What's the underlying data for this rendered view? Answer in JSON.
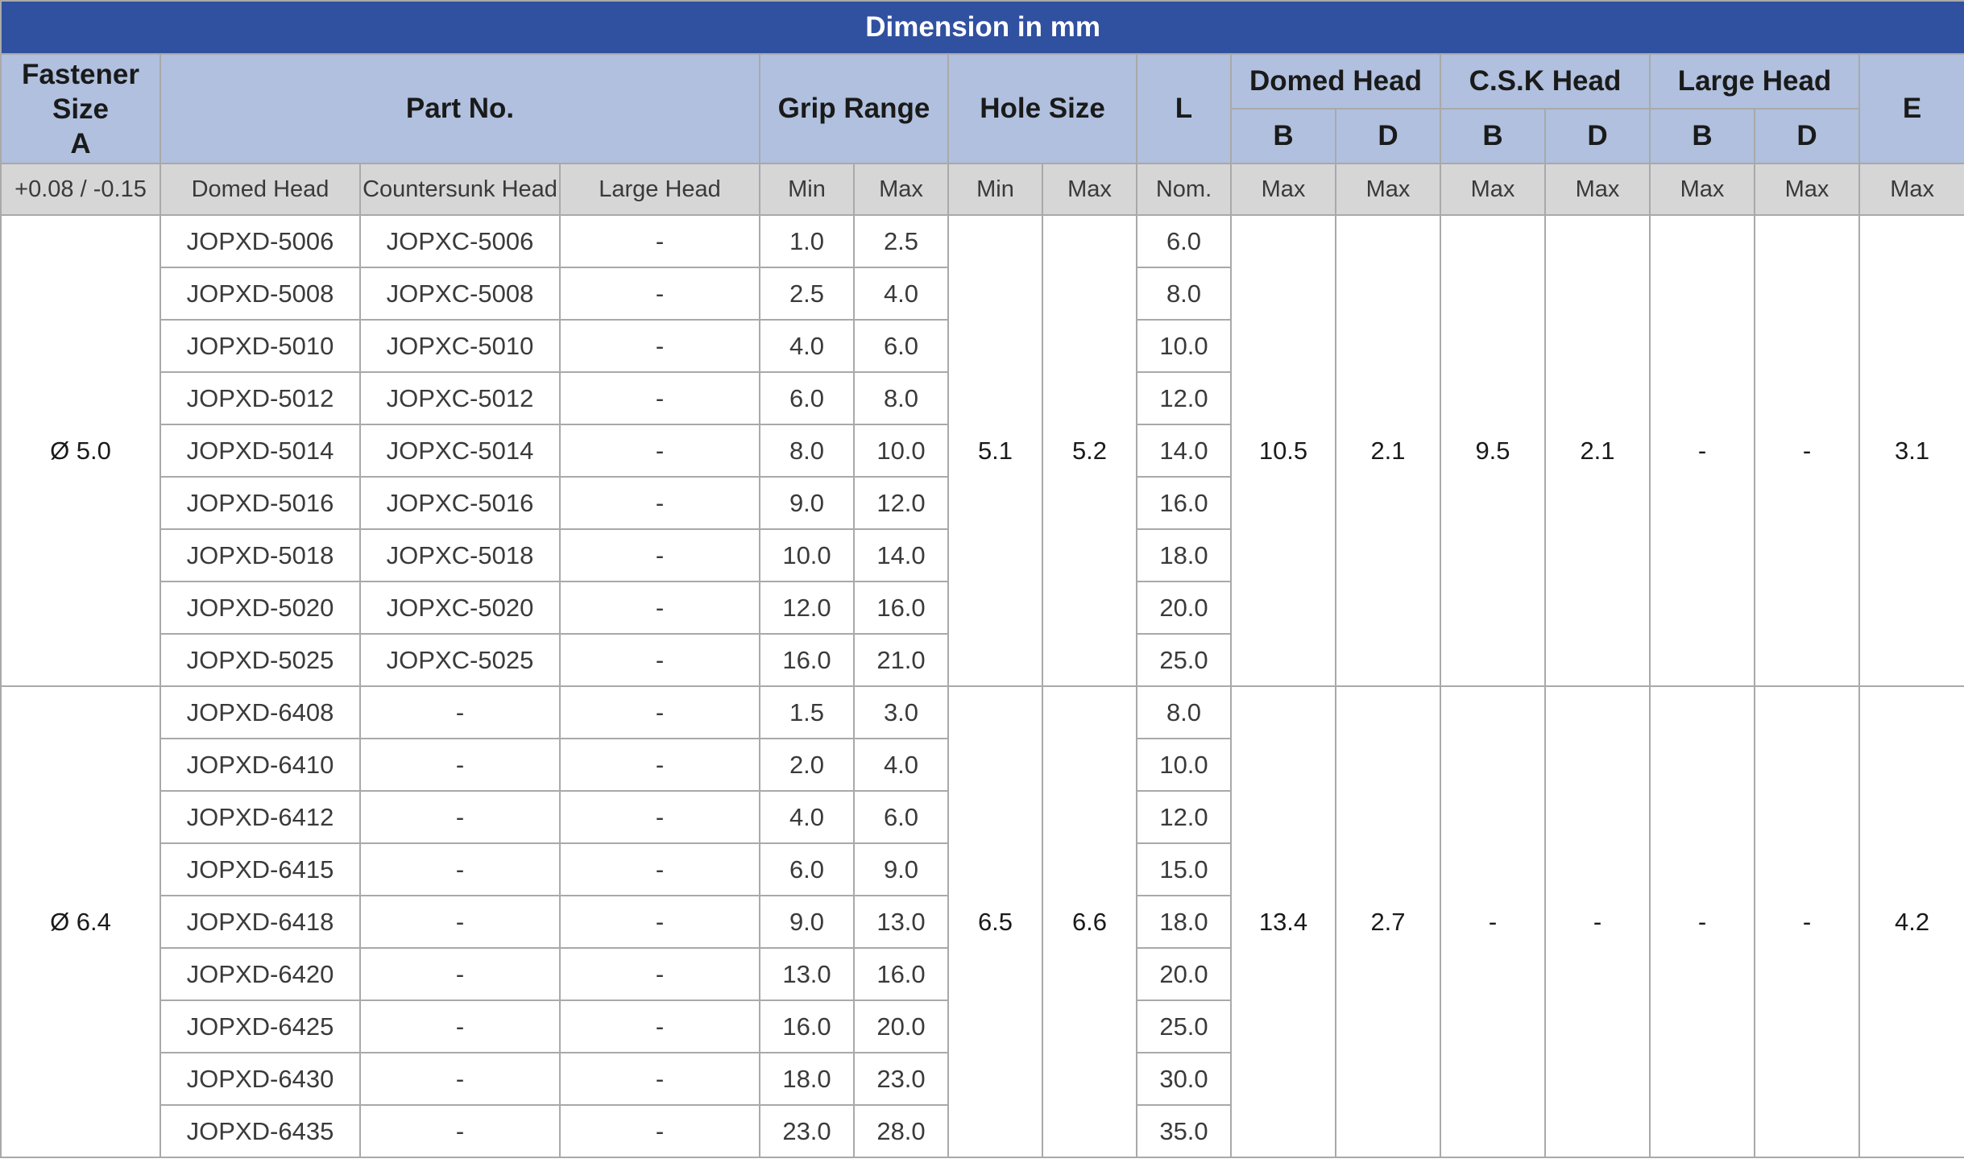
{
  "title": "Dimension in mm",
  "headers": {
    "fastener_size": [
      "Fastener",
      "Size",
      "A"
    ],
    "part_no": "Part No.",
    "grip_range": "Grip Range",
    "hole_size": "Hole Size",
    "l": "L",
    "domed_head": "Domed Head",
    "csk_head": "C.S.K Head",
    "large_head": "Large Head",
    "e": "E",
    "b": "B",
    "d": "D"
  },
  "subheaders": [
    "+0.08 / -0.15",
    "Domed Head",
    "Countersunk Head",
    "Large Head",
    "Min",
    "Max",
    "Min",
    "Max",
    "Nom.",
    "Max",
    "Max",
    "Max",
    "Max",
    "Max",
    "Max",
    "Max"
  ],
  "groups": [
    {
      "size": "Ø 5.0",
      "hole_min": "5.1",
      "hole_max": "5.2",
      "domed_b": "10.5",
      "domed_d": "2.1",
      "csk_b": "9.5",
      "csk_d": "2.1",
      "large_b": "-",
      "large_d": "-",
      "e": "3.1",
      "rows": [
        [
          "JOPXD-5006",
          "JOPXC-5006",
          "-",
          "1.0",
          "2.5",
          "6.0"
        ],
        [
          "JOPXD-5008",
          "JOPXC-5008",
          "-",
          "2.5",
          "4.0",
          "8.0"
        ],
        [
          "JOPXD-5010",
          "JOPXC-5010",
          "-",
          "4.0",
          "6.0",
          "10.0"
        ],
        [
          "JOPXD-5012",
          "JOPXC-5012",
          "-",
          "6.0",
          "8.0",
          "12.0"
        ],
        [
          "JOPXD-5014",
          "JOPXC-5014",
          "-",
          "8.0",
          "10.0",
          "14.0"
        ],
        [
          "JOPXD-5016",
          "JOPXC-5016",
          "-",
          "9.0",
          "12.0",
          "16.0"
        ],
        [
          "JOPXD-5018",
          "JOPXC-5018",
          "-",
          "10.0",
          "14.0",
          "18.0"
        ],
        [
          "JOPXD-5020",
          "JOPXC-5020",
          "-",
          "12.0",
          "16.0",
          "20.0"
        ],
        [
          "JOPXD-5025",
          "JOPXC-5025",
          "-",
          "16.0",
          "21.0",
          "25.0"
        ]
      ]
    },
    {
      "size": "Ø 6.4",
      "hole_min": "6.5",
      "hole_max": "6.6",
      "domed_b": "13.4",
      "domed_d": "2.7",
      "csk_b": "-",
      "csk_d": "-",
      "large_b": "-",
      "large_d": "-",
      "e": "4.2",
      "rows": [
        [
          "JOPXD-6408",
          "-",
          "-",
          "1.5",
          "3.0",
          "8.0"
        ],
        [
          "JOPXD-6410",
          "-",
          "-",
          "2.0",
          "4.0",
          "10.0"
        ],
        [
          "JOPXD-6412",
          "-",
          "-",
          "4.0",
          "6.0",
          "12.0"
        ],
        [
          "JOPXD-6415",
          "-",
          "-",
          "6.0",
          "9.0",
          "15.0"
        ],
        [
          "JOPXD-6418",
          "-",
          "-",
          "9.0",
          "13.0",
          "18.0"
        ],
        [
          "JOPXD-6420",
          "-",
          "-",
          "13.0",
          "16.0",
          "20.0"
        ],
        [
          "JOPXD-6425",
          "-",
          "-",
          "16.0",
          "20.0",
          "25.0"
        ],
        [
          "JOPXD-6430",
          "-",
          "-",
          "18.0",
          "23.0",
          "30.0"
        ],
        [
          "JOPXD-6435",
          "-",
          "-",
          "23.0",
          "28.0",
          "35.0"
        ]
      ]
    }
  ]
}
